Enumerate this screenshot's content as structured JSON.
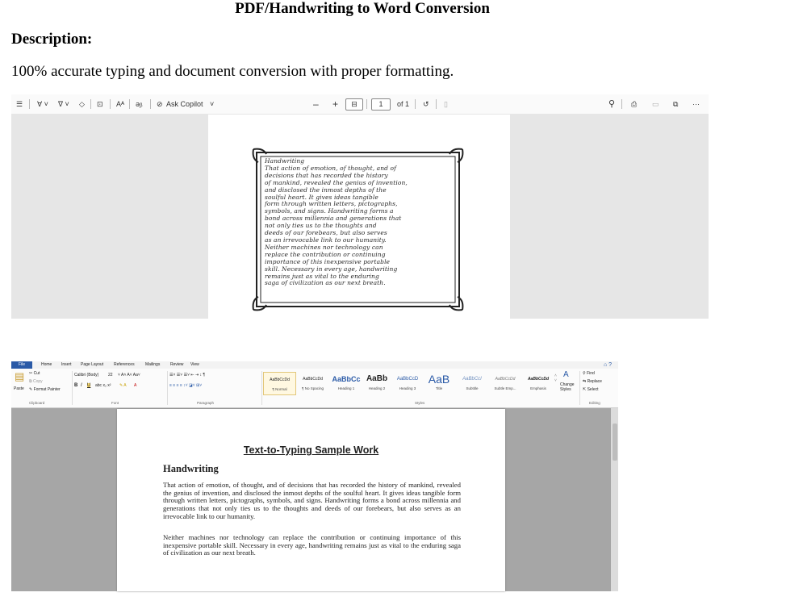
{
  "page": {
    "title": "PDF/Handwriting to Word Conversion",
    "subheading": "Description:",
    "description": "100% accurate typing and document conversion with proper formatting."
  },
  "pdf_viewer": {
    "ask_copilot": "Ask Copilot",
    "zoom_out": "–",
    "zoom_in": "+",
    "page_number": "1",
    "page_total": "of 1",
    "more": "···",
    "handwriting_title": "Handwriting",
    "handwriting_lines": [
      "That action of emotion, of thought, and of",
      "decisions that has recorded the history",
      "of mankind, revealed the genius of invention,",
      "and disclosed the inmost depths of the",
      "soulful heart. It gives ideas tangible",
      "form through written letters, pictographs,",
      "symbols, and signs. Handwriting forms a",
      "bond across millennia and generations that",
      "not only ties us to the thoughts and",
      "deeds of our forebears, but also serves",
      "as an irrevocable link to our humanity.",
      "Neither machines nor technology can",
      "replace the contribution or continuing",
      "importance of this inexpensive portable",
      "skill. Necessary in every age, handwriting",
      "remains just as vital to the enduring",
      "saga of civilization as our next breath."
    ]
  },
  "word": {
    "tabs": [
      "File",
      "Home",
      "Insert",
      "Page Layout",
      "References",
      "Mailings",
      "Review",
      "View"
    ],
    "clipboard": {
      "paste": "Paste",
      "cut": "Cut",
      "copy": "Copy",
      "format_painter": "Format Painter",
      "label": "Clipboard"
    },
    "font": {
      "name": "Calibri (Body)",
      "size": "22",
      "label": "Font"
    },
    "paragraph_label": "Paragraph",
    "styles": [
      {
        "preview": "AaBbCcDd",
        "name": "¶ Normal"
      },
      {
        "preview": "AaBbCcDd",
        "name": "¶ No Spacing"
      },
      {
        "preview": "AaBbCc",
        "name": "Heading 1"
      },
      {
        "preview": "AaBb",
        "name": "Heading 2"
      },
      {
        "preview": "AaBbCcD",
        "name": "Heading 3"
      },
      {
        "preview": "AaB",
        "name": "Title"
      },
      {
        "preview": "AaBbCcI",
        "name": "Subtitle"
      },
      {
        "preview": "AaBbCcDd",
        "name": "Subtle Emp..."
      },
      {
        "preview": "AaBbCcDd",
        "name": "Emphasis"
      }
    ],
    "change_styles": "Change Styles",
    "styles_label": "Styles",
    "editing": {
      "find": "Find",
      "replace": "Replace",
      "select": "Select",
      "label": "Editing"
    },
    "document": {
      "title": "Text-to-Typing Sample Work",
      "heading": "Handwriting",
      "paragraph1": "That action of emotion, of thought, and of decisions that has recorded the history of mankind, revealed the genius of invention, and disclosed the inmost depths of the soulful heart. It gives ideas tangible form through written letters, pictographs, symbols, and signs. Handwriting forms a bond across millennia and generations that not only ties us to the thoughts and deeds of our forebears, but also serves as an irrevocable link to our humanity.",
      "paragraph2": "Neither machines nor technology can replace the contribution or continuing importance of this inexpensive portable skill. Necessary in every age, handwriting remains just as vital to the enduring saga of civilization as our next breath."
    }
  }
}
